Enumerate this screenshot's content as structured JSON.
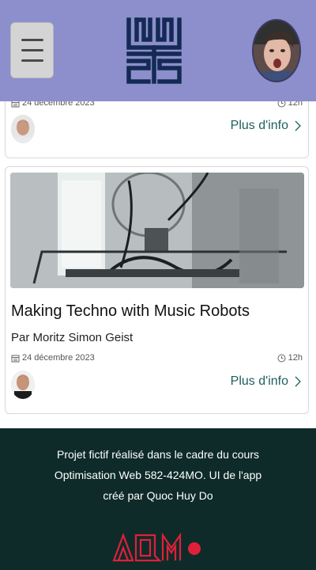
{
  "header": {
    "menu_icon": "hamburger-menu-icon",
    "logo_icon": "maze-logo-icon",
    "avatar_icon": "user-avatar"
  },
  "cards": [
    {
      "date": "24 décembre 2023",
      "duration": "12h",
      "more_label": "Plus d'info"
    },
    {
      "title": "Making Techno with Music Robots",
      "author": "Par Moritz Simon Geist",
      "date": "24 décembre 2023",
      "duration": "12h",
      "more_label": "Plus d'info"
    }
  ],
  "footer": {
    "line1": "Projet fictif réalisé dans le cadre du cours",
    "line2": "Optimisation Web 582-424MO. UI de l'app",
    "line3": "créé par Quoc Huy Do",
    "logo_icon": "aqm-logo",
    "brand_color": "#e0203a"
  },
  "colors": {
    "header_bg": "#8c8fcb",
    "footer_bg": "#0e2b29",
    "link": "#1f5e5e"
  }
}
